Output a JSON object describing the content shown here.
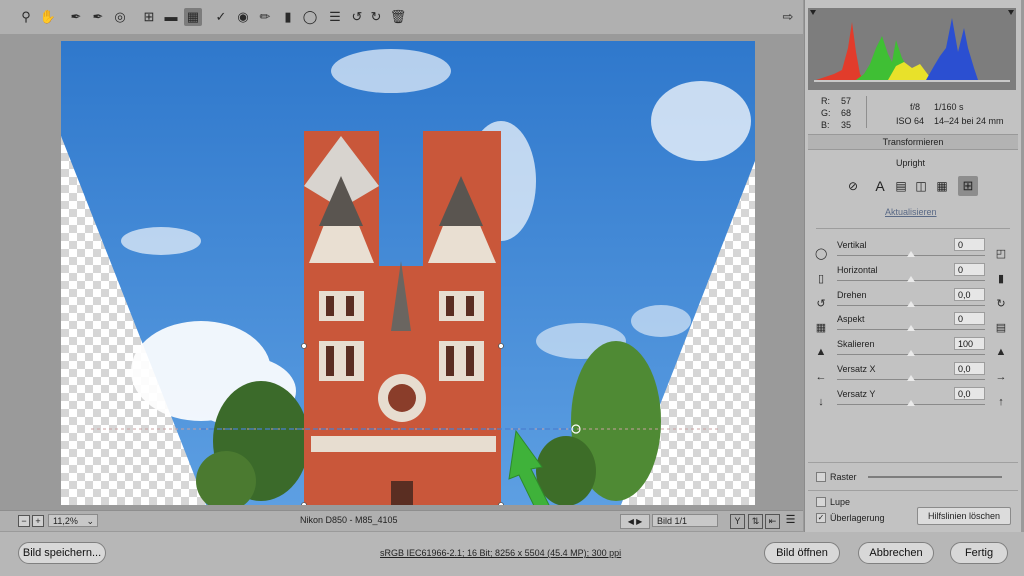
{
  "toolbar": {
    "tools": [
      "zoom-icon",
      "hand-icon",
      "white-balance-icon",
      "color-sampler-icon",
      "target-adjust-icon",
      "crop-icon",
      "straighten-icon",
      "transform-icon",
      "spot-removal-icon",
      "red-eye-icon",
      "brush-icon",
      "graduated-filter-icon",
      "radial-filter-icon",
      "presets-list-icon",
      "rotate-left-icon",
      "rotate-right-icon",
      "trash-icon"
    ],
    "fullscreen": "export-icon"
  },
  "status_bar": {
    "zoom": "11,2%",
    "filename": "Nikon D850 - M85_4105",
    "image_counter": "Bild 1/1"
  },
  "histogram": {
    "r_label": "R:",
    "r_value": "57",
    "g_label": "G:",
    "g_value": "68",
    "b_label": "B:",
    "b_value": "35",
    "aperture": "f/8",
    "shutter": "1/160 s",
    "iso": "ISO 64",
    "lens": "14–24 bei 24 mm"
  },
  "panel": {
    "section_title": "Transformieren",
    "upright_label": "Upright",
    "update_link": "Aktualisieren",
    "sliders": [
      {
        "label": "Vertikal",
        "value": "0",
        "position": 0.5
      },
      {
        "label": "Horizontal",
        "value": "0",
        "position": 0.5
      },
      {
        "label": "Drehen",
        "value": "0,0",
        "position": 0.5
      },
      {
        "label": "Aspekt",
        "value": "0",
        "position": 0.5
      },
      {
        "label": "Skalieren",
        "value": "100",
        "position": 0.5
      },
      {
        "label": "Versatz X",
        "value": "0,0",
        "position": 0.5
      },
      {
        "label": "Versatz Y",
        "value": "0,0",
        "position": 0.5
      }
    ],
    "grid_label": "Raster",
    "loupe_label": "Lupe",
    "overlay_label": "Überlagerung",
    "overlay_checked": true,
    "clear_guides_button": "Hilfslinien löschen"
  },
  "footer": {
    "save_button": "Bild speichern...",
    "workflow_info": "sRGB IEC61966-2.1; 16 Bit; 8256 x 5504 (45.4 MP); 300 ppi",
    "open_button": "Bild öffnen",
    "cancel_button": "Abbrechen",
    "done_button": "Fertig"
  },
  "colors": {
    "sky": "#3d86d6",
    "brick": "#c7563a",
    "arrow": "#3fb23a",
    "guide": "#4a7fd0"
  }
}
